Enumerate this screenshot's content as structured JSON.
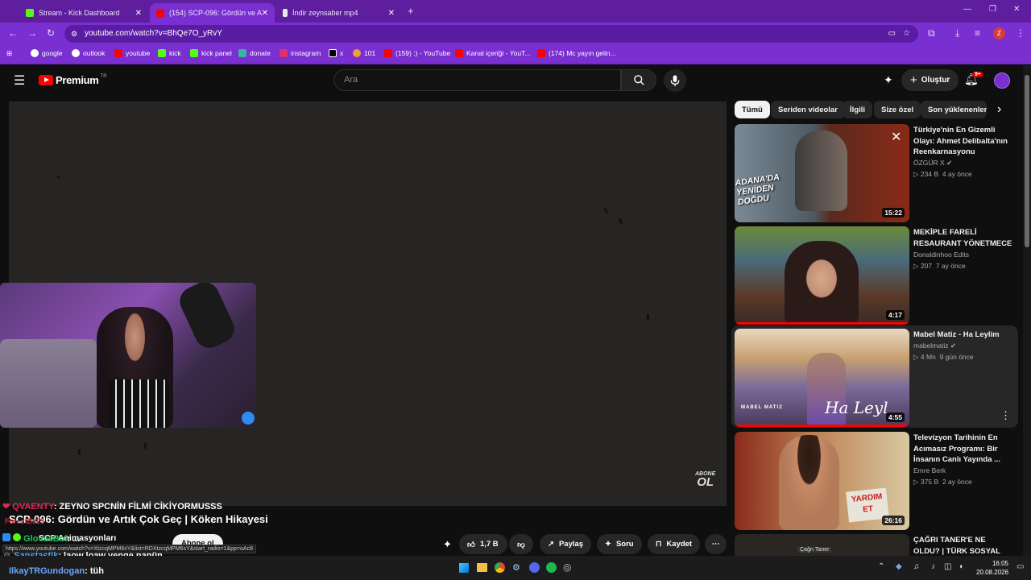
{
  "browser": {
    "tabs": [
      {
        "label": "Stream - Kick Dashboard",
        "active": false
      },
      {
        "label": "(154) SCP-096: Gördün ve Artık",
        "active": true
      },
      {
        "label": "İndir zeynsaber mp4",
        "active": false
      }
    ],
    "url": "youtube.com/watch?v=BhQe7O_yRvY",
    "bookmarks": [
      "google",
      "outlook",
      "youtube",
      "kick",
      "kick panel",
      "donate",
      "instagram",
      "x",
      "101",
      "(159) :) - YouTube",
      "Kanal içeriği - YouT...",
      "(174) Mc yayın gelin..."
    ],
    "profile_initial": "Z"
  },
  "youtube": {
    "logo_text": "Premium",
    "logo_region": "TR",
    "search_placeholder": "Ara",
    "create_label": "Oluştur",
    "notif_count": "9+",
    "chips": [
      "Tümü",
      "Seriden videolar",
      "İlgili",
      "Size özel",
      "Son yüklenenler"
    ],
    "recommendations": [
      {
        "title": "Türkiye'nin En Gizemli Olayı: Ahmet Delibalta'nın Reenkarnasyonu",
        "channel": "ÖZGÜR X",
        "views": "234 B",
        "age": "4 ay önce",
        "duration": "15:22",
        "thumb_text": "ADANA'DA YENİDEN DOĞDU"
      },
      {
        "title": "MEKİPLE FARELİ RESAURANT YÖNETMECE",
        "channel": "Donaldinhoo Edits",
        "views": "207",
        "age": "7 ay önce",
        "duration": "4:17"
      },
      {
        "title": "Mabel Matiz - Ha Leylim",
        "channel": "mabelmatiz",
        "views": "4 Mn",
        "age": "9 gün önce",
        "duration": "4:55",
        "thumb_text": "Ha Leyl",
        "thumb_brand": "MABEL MATIZ"
      },
      {
        "title": "Televizyon Tarihinin En Acımasız Programı: Bir İnsanın Canlı Yayında ...",
        "channel": "Emre Berk",
        "views": "375 B",
        "age": "2 ay önce",
        "duration": "26:16",
        "thumb_text": "YARDIM ET"
      },
      {
        "title": "ÇAĞRI TANER'E NE OLDU? | TÜRK SOSYAL MEDYASININ",
        "thumb_text": "Çağrı Taner"
      }
    ],
    "video_title": "SCP-096: Gördün ve Artık Çok Geç | Köken Hikayesi",
    "channel_name": "SCP Animasyonları",
    "subscribe_label": "Abone ol",
    "likes": "1,7 B",
    "share_label": "Paylaş",
    "ask_label": "Soru",
    "save_label": "Kaydet",
    "watermark_line1": "ABONE",
    "watermark_line2": "OL",
    "status_url": "https://www.youtube.com/watch?v=XtzcqMPM6sY&list=RDXtzcqMPM6sY&start_radio=1&pp=oAc8"
  },
  "chat": [
    {
      "user": "QVAENTY",
      "text": ": ZEYNO SPCNİN FİLMİ CİKİYORMUSSS",
      "color": "#e0295a"
    },
    {
      "user": "ForestBe23",
      "text": "",
      "color": "#d0282f"
    },
    {
      "user": "GlovesBoi",
      "text": ": ...",
      "color": "#1cc45a"
    },
    {
      "user": "Sanstastik",
      "text": ": laow loaw yenge napün",
      "color": "#4aa8ff"
    },
    {
      "user": "IlkayTRGundogan",
      "text": ": tüh",
      "color": "#6aa6ff"
    }
  ],
  "taskbar": {
    "time": "16:05",
    "date": "20.08.2026"
  },
  "colors": {
    "browser_purple": "#7a2fd0",
    "tab_purple": "#5e1e9e",
    "yt_red": "#ff0000",
    "bg": "#0f0f0f"
  }
}
